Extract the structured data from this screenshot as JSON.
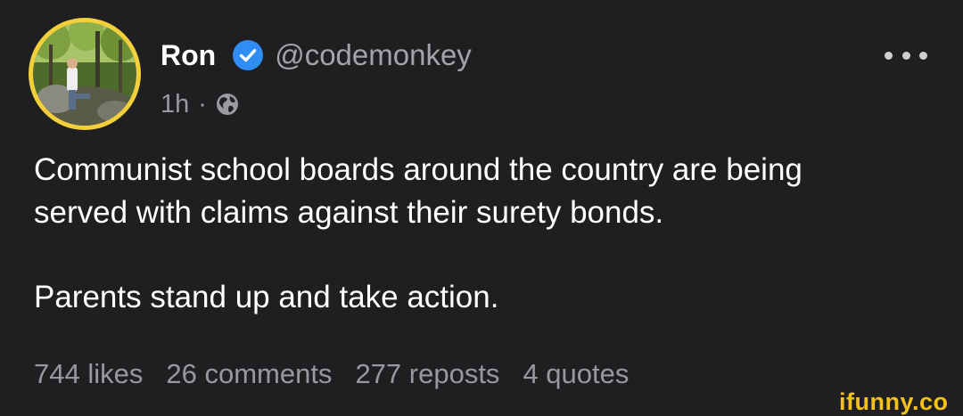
{
  "post": {
    "display_name": "Ron",
    "handle": "@codemonkey",
    "time": "1h",
    "separator": "·",
    "visibility_icon": "globe-icon",
    "verified_icon": "verified-badge-icon",
    "more_icon": "more-options-icon",
    "text": {
      "line1": "Communist school boards around the country are being",
      "line2": "served with claims against their surety bonds.",
      "line3": "Parents stand up and take action."
    },
    "stats": {
      "likes": "744 likes",
      "comments": "26 comments",
      "reposts": "277 reposts",
      "quotes": "4 quotes"
    }
  },
  "watermark": "ifunny.co",
  "colors": {
    "background": "#1f1f21",
    "avatar_ring": "#f2d03b",
    "verified_blue": "#2f8df4",
    "watermark": "#f2c21b"
  }
}
